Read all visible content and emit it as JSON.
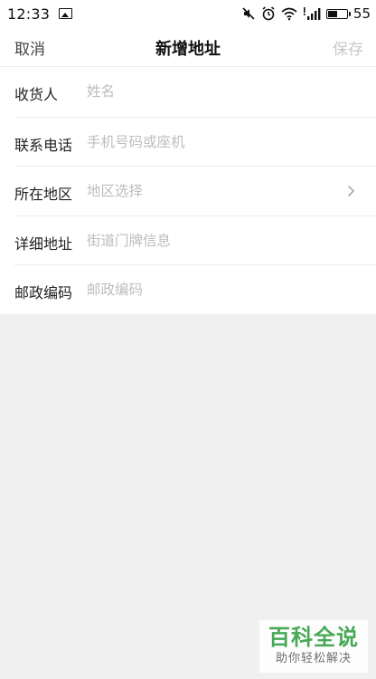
{
  "status_bar": {
    "time": "12:33",
    "battery_percent": "55",
    "battery_level": 0.55
  },
  "header": {
    "cancel_label": "取消",
    "title": "新增地址",
    "save_label": "保存"
  },
  "form": {
    "recipient": {
      "label": "收货人",
      "placeholder": "姓名",
      "value": ""
    },
    "phone": {
      "label": "联系电话",
      "placeholder": "手机号码或座机",
      "value": ""
    },
    "region": {
      "label": "所在地区",
      "placeholder": "地区选择",
      "value": ""
    },
    "address": {
      "label": "详细地址",
      "placeholder": "街道门牌信息",
      "value": ""
    },
    "postcode": {
      "label": "邮政编码",
      "placeholder": "邮政编码",
      "value": ""
    }
  },
  "watermark": {
    "main": "百科全说",
    "sub": "助你轻松解决"
  },
  "colors": {
    "background": "#f0f0f0",
    "surface": "#ffffff",
    "placeholder": "#bdbdbd",
    "disabled_save": "#c8c8c8",
    "watermark_green": "#3aa34a"
  }
}
